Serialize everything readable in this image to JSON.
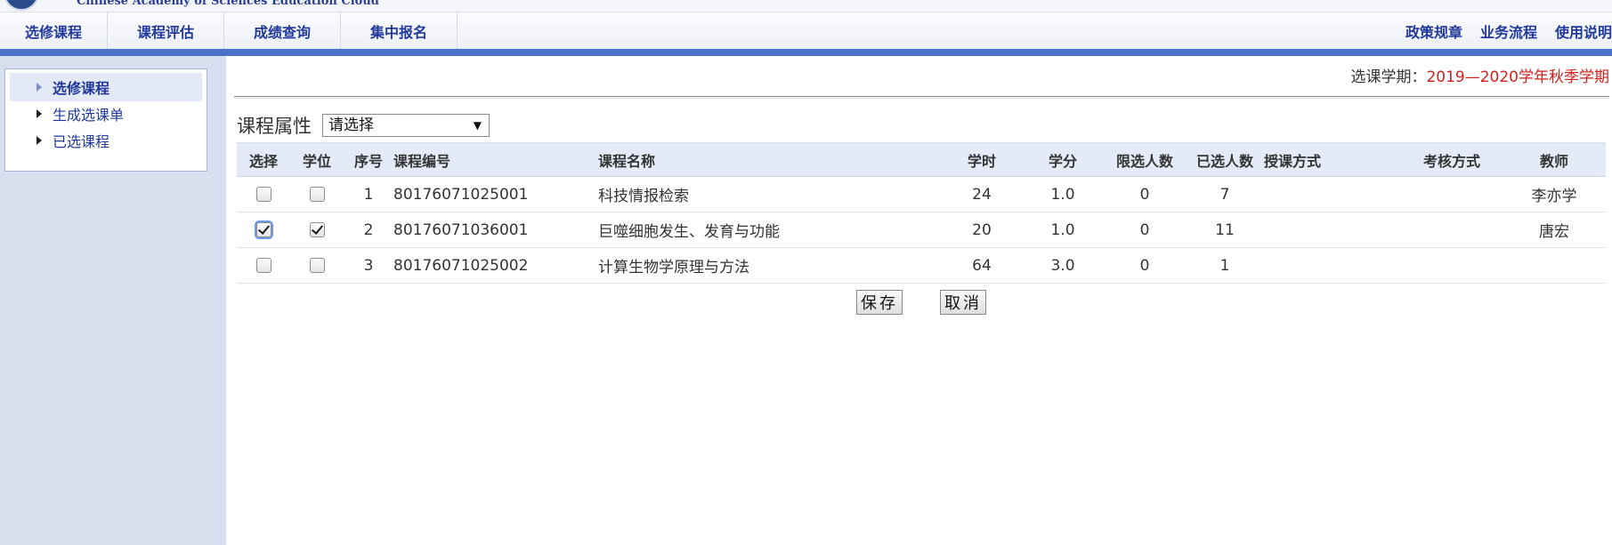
{
  "header": {
    "logo_subtitle": "Chinese Academy of Sciences Education Cloud"
  },
  "nav": {
    "left_items": [
      "选修课程",
      "课程评估",
      "成绩查询",
      "集中报名"
    ],
    "right_items": [
      "政策规章",
      "业务流程",
      "使用说明"
    ]
  },
  "sidebar": {
    "items": [
      {
        "label": "选修课程",
        "active": true
      },
      {
        "label": "生成选课单",
        "active": false
      },
      {
        "label": "已选课程",
        "active": false
      }
    ]
  },
  "term": {
    "label": "选课学期：",
    "value": "2019—2020学年秋季学期"
  },
  "filter": {
    "label": "课程属性",
    "selected": "请选择"
  },
  "table": {
    "headers": [
      "选择",
      "学位",
      "序号",
      "课程编号",
      "课程名称",
      "学时",
      "学分",
      "限选人数",
      "已选人数",
      "授课方式",
      "考核方式",
      "教师"
    ],
    "rows": [
      {
        "select": false,
        "degree": false,
        "seq": "1",
        "code": "80176071025001",
        "name": "科技情报检索",
        "hours": "24",
        "credits": "1.0",
        "limit": "0",
        "enrolled": "7",
        "mode": "",
        "exam": "",
        "teacher": "李亦学"
      },
      {
        "select": true,
        "degree": true,
        "seq": "2",
        "code": "80176071036001",
        "name": "巨噬细胞发生、发育与功能",
        "hours": "20",
        "credits": "1.0",
        "limit": "0",
        "enrolled": "11",
        "mode": "",
        "exam": "",
        "teacher": "唐宏"
      },
      {
        "select": false,
        "degree": false,
        "seq": "3",
        "code": "80176071025002",
        "name": "计算生物学原理与方法",
        "hours": "64",
        "credits": "3.0",
        "limit": "0",
        "enrolled": "1",
        "mode": "",
        "exam": "",
        "teacher": ""
      }
    ]
  },
  "buttons": {
    "save": "保存",
    "cancel": "取消"
  },
  "colors": {
    "accent": "#4a72c8",
    "link": "#20399a",
    "term_highlight": "#d4201c",
    "sidebar_bg": "#d8dfee"
  }
}
